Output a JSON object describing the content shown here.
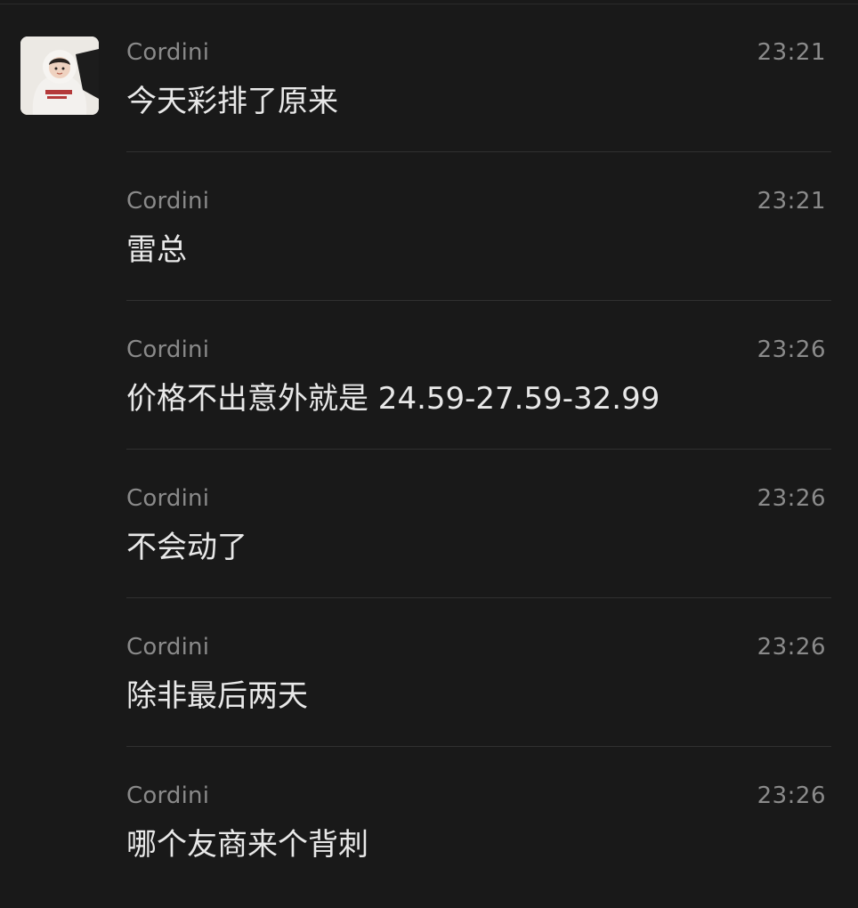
{
  "chat": {
    "messages": [
      {
        "sender": "Cordini",
        "time": "23:21",
        "text": "今天彩排了原来"
      },
      {
        "sender": "Cordini",
        "time": "23:21",
        "text": "雷总"
      },
      {
        "sender": "Cordini",
        "time": "23:26",
        "text": "价格不出意外就是 24.59-27.59-32.99"
      },
      {
        "sender": "Cordini",
        "time": "23:26",
        "text": "不会动了"
      },
      {
        "sender": "Cordini",
        "time": "23:26",
        "text": "除非最后两天"
      },
      {
        "sender": "Cordini",
        "time": "23:26",
        "text": "哪个友商来个背刺"
      }
    ]
  },
  "colors": {
    "background": "#191919",
    "text_primary": "#e8e8e8",
    "text_secondary": "#8a8a8a",
    "divider": "#303030"
  }
}
